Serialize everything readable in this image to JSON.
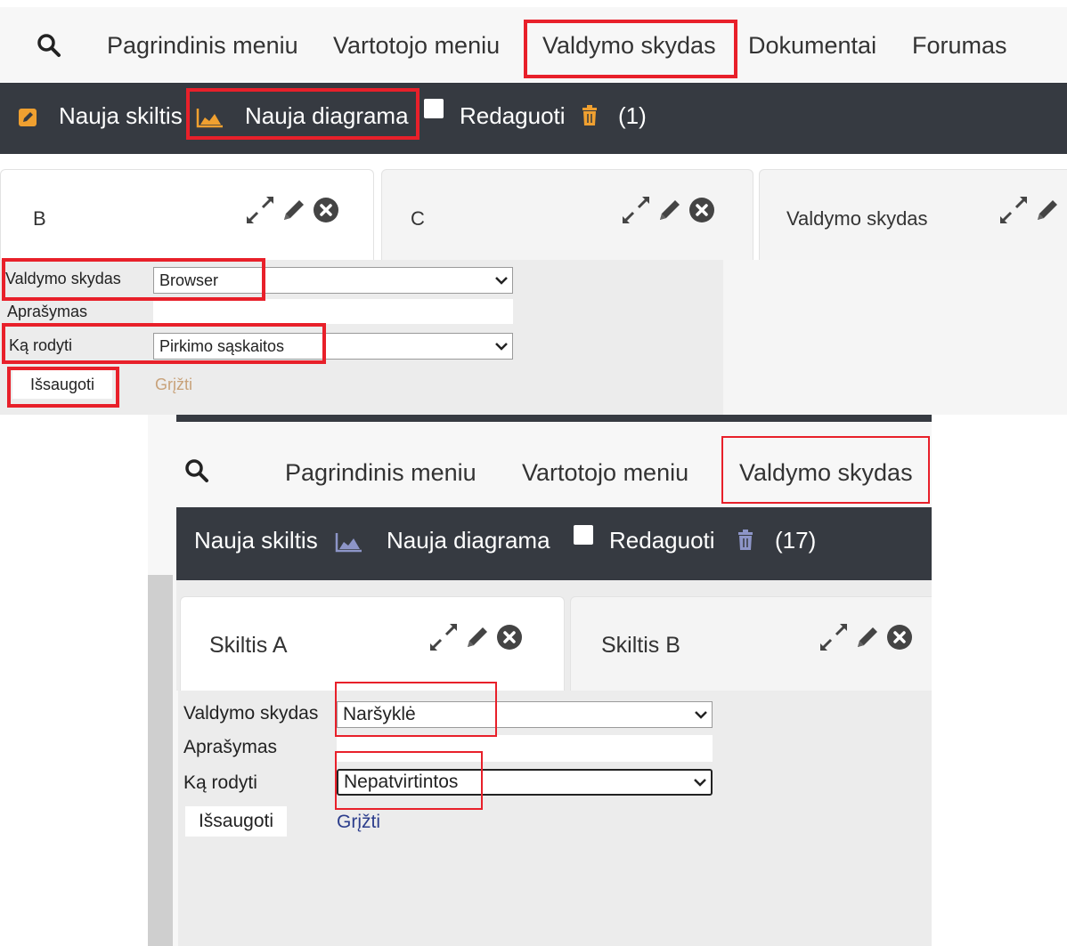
{
  "screenshot_1": {
    "nav": {
      "search_icon": "search-icon",
      "items": [
        "Pagrindinis meniu",
        "Vartotojo meniu",
        "Valdymo skydas",
        "Dokumentai",
        "Forumas"
      ]
    },
    "toolbar": {
      "new_column": "Nauja skiltis",
      "new_chart": "Nauja diagrama",
      "edit": "Redaguoti",
      "trash_count": "(1)"
    },
    "tabs": [
      {
        "title": "B"
      },
      {
        "title": "C"
      },
      {
        "title": "Valdymo skydas"
      }
    ],
    "form": {
      "dashboard_label": "Valdymo skydas",
      "dashboard_value": "Browser",
      "description_label": "Aprašymas",
      "description_value": "",
      "show_label": "Ką rodyti",
      "show_value": "Pirkimo sąskaitos",
      "save": "Išsaugoti",
      "back": "Grįžti"
    }
  },
  "screenshot_2": {
    "nav": {
      "search_icon": "search-icon",
      "items": [
        "Pagrindinis meniu",
        "Vartotojo meniu",
        "Valdymo skydas"
      ]
    },
    "toolbar": {
      "new_column": "Nauja skiltis",
      "new_chart": "Nauja diagrama",
      "edit": "Redaguoti",
      "trash_count": "(17)"
    },
    "tabs": [
      {
        "title": "Skiltis A"
      },
      {
        "title": "Skiltis B"
      }
    ],
    "form": {
      "dashboard_label": "Valdymo skydas",
      "dashboard_value": "Naršyklė",
      "description_label": "Aprašymas",
      "description_value": "",
      "show_label": "Ką rodyti",
      "show_value": "Nepatvirtintos",
      "save": "Išsaugoti",
      "back": "Grįžti"
    }
  },
  "colors": {
    "highlight": "#e8202a",
    "toolbar_bg": "#363a41",
    "edit_icon_orange": "#f0a030",
    "trash_orange": "#f0a030",
    "trash_blue": "#8d95c8",
    "link_tan": "#c8a27a",
    "link_navy": "#2c3e8c"
  }
}
